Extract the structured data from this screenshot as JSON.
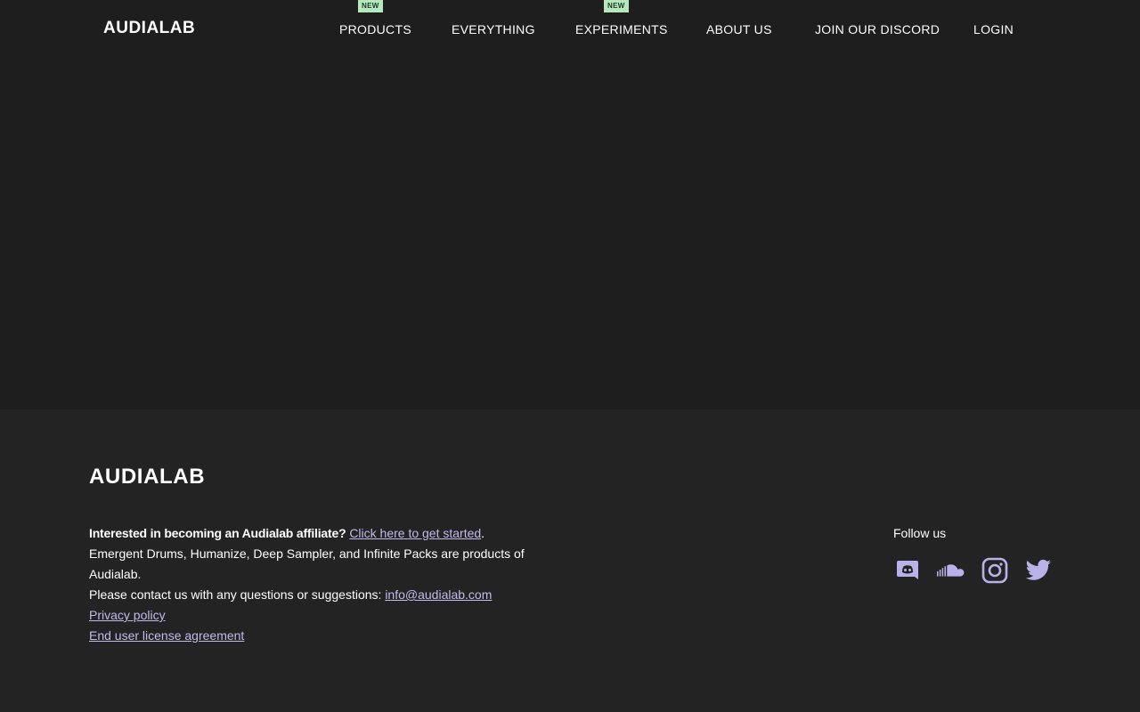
{
  "header": {
    "logo": "AUDIALAB",
    "nav": [
      {
        "label": "PRODUCTS",
        "badge": "NEW"
      },
      {
        "label": "EVERYTHING"
      },
      {
        "label": "EXPERIMENTS",
        "badge": "NEW"
      },
      {
        "label": "ABOUT US"
      },
      {
        "label": "JOIN OUR DISCORD"
      },
      {
        "label": "LOGIN"
      }
    ]
  },
  "footer": {
    "logo": "AUDIALAB",
    "affiliate_question": "Interested in becoming an Audialab affiliate?",
    "affiliate_link": "Click here to get started",
    "affiliate_period": ".",
    "products_text": "Emergent Drums, Humanize, Deep Sampler, and Infinite Packs are products of Audialab.",
    "contact_text": "Please contact us with any questions or suggestions:",
    "contact_email": "info@audialab.com",
    "privacy_link": "Privacy policy",
    "eula_link": "End user license agreement",
    "follow_label": "Follow us",
    "socials": [
      {
        "icon": "discord-icon"
      },
      {
        "icon": "soundcloud-icon"
      },
      {
        "icon": "instagram-icon"
      },
      {
        "icon": "twitter-icon"
      }
    ]
  },
  "colors": {
    "background": "#1e1e1e",
    "footer_background": "#232323",
    "link": "#c3b9ea",
    "badge_background": "#b6e8bd",
    "icon": "#b9b2e8"
  }
}
